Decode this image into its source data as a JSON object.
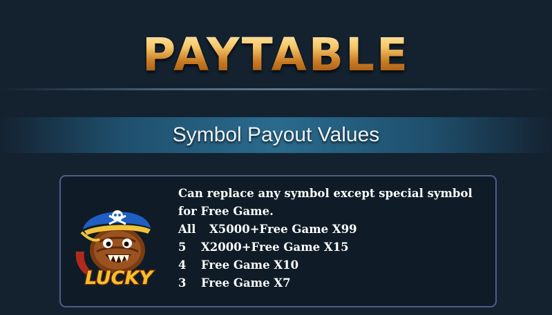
{
  "title": "PAYTABLE",
  "section_title": "Symbol Payout Values",
  "symbol": {
    "icon": "lucky-pirate-wild-icon",
    "logo_text": "LUCKY",
    "description": "Can replace any symbol except special symbol for Free Game.",
    "payouts": [
      {
        "count": "All",
        "reward": "X5000+Free Game X99"
      },
      {
        "count": "5",
        "reward": "X2000+Free Game X15"
      },
      {
        "count": "4",
        "reward": "Free Game X10"
      },
      {
        "count": "3",
        "reward": "Free Game X7"
      }
    ]
  },
  "colors": {
    "background": "#142230",
    "title_gold": "#e9a642",
    "card_border": "#4d5f8a",
    "banner_blue": "#2a6b8d"
  }
}
